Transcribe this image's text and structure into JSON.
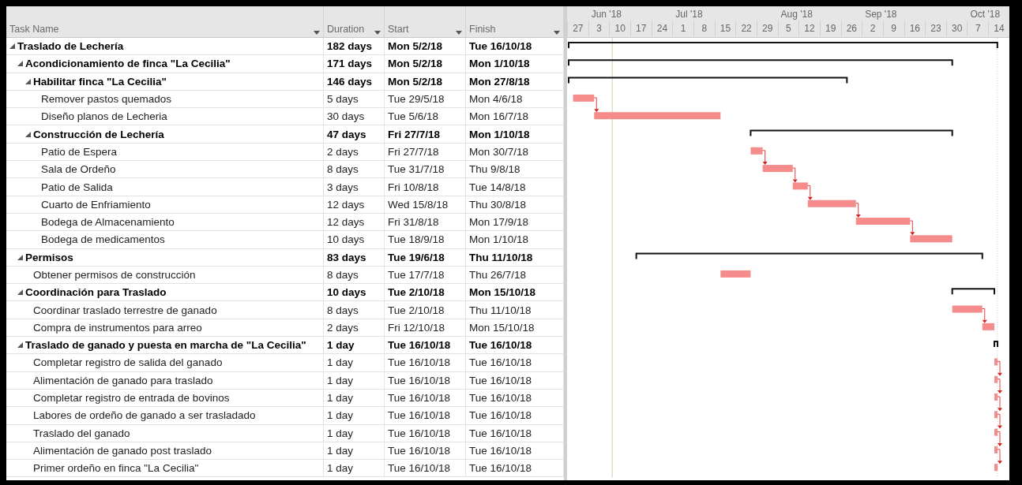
{
  "table": {
    "columns": [
      "Task Name",
      "Duration",
      "Start",
      "Finish"
    ],
    "rows": [
      {
        "kind": "summary",
        "expanded": true,
        "name": "Traslado de Lechería",
        "duration": "182 days",
        "start": "Mon 5/2/18",
        "finish": "Tue 16/10/18",
        "children": [
          {
            "kind": "summary",
            "expanded": true,
            "name": "Acondicionamiento de finca \"La Cecilia\"",
            "duration": "171 days",
            "start": "Mon 5/2/18",
            "finish": "Mon 1/10/18",
            "children": [
              {
                "kind": "summary",
                "expanded": true,
                "name": "Habilitar finca \"La Cecilia\"",
                "duration": "146 days",
                "start": "Mon 5/2/18",
                "finish": "Mon 27/8/18",
                "children": [
                  {
                    "kind": "task",
                    "name": "Remover pastos quemados",
                    "duration": "5 days",
                    "start": "Tue 29/5/18",
                    "finish": "Mon 4/6/18"
                  },
                  {
                    "kind": "task",
                    "name": "Diseño planos de Lecheria",
                    "duration": "30 days",
                    "start": "Tue 5/6/18",
                    "finish": "Mon 16/7/18"
                  }
                ]
              },
              {
                "kind": "summary",
                "expanded": true,
                "name": "Construcción de Lechería",
                "duration": "47 days",
                "start": "Fri 27/7/18",
                "finish": "Mon 1/10/18",
                "children": [
                  {
                    "kind": "task",
                    "name": "Patio de Espera",
                    "duration": "2 days",
                    "start": "Fri 27/7/18",
                    "finish": "Mon 30/7/18"
                  },
                  {
                    "kind": "task",
                    "name": "Sala de Ordeño",
                    "duration": "8 days",
                    "start": "Tue 31/7/18",
                    "finish": "Thu 9/8/18"
                  },
                  {
                    "kind": "task",
                    "name": "Patio de Salida",
                    "duration": "3 days",
                    "start": "Fri 10/8/18",
                    "finish": "Tue 14/8/18"
                  },
                  {
                    "kind": "task",
                    "name": "Cuarto de Enfriamiento",
                    "duration": "12 days",
                    "start": "Wed 15/8/18",
                    "finish": "Thu 30/8/18"
                  },
                  {
                    "kind": "task",
                    "name": "Bodega de Almacenamiento",
                    "duration": "12 days",
                    "start": "Fri 31/8/18",
                    "finish": "Mon 17/9/18"
                  },
                  {
                    "kind": "task",
                    "name": "Bodega de medicamentos",
                    "duration": "10 days",
                    "start": "Tue 18/9/18",
                    "finish": "Mon 1/10/18"
                  }
                ]
              }
            ]
          },
          {
            "kind": "summary",
            "expanded": true,
            "name": "Permisos",
            "duration": "83 days",
            "start": "Tue 19/6/18",
            "finish": "Thu 11/10/18",
            "children": [
              {
                "kind": "task",
                "name": "Obtener permisos de construcción",
                "duration": "8 days",
                "start": "Tue 17/7/18",
                "finish": "Thu 26/7/18"
              }
            ]
          },
          {
            "kind": "summary",
            "expanded": true,
            "name": "Coordinación para Traslado",
            "duration": "10 days",
            "start": "Tue 2/10/18",
            "finish": "Mon 15/10/18",
            "children": [
              {
                "kind": "task",
                "name": "Coordinar traslado terrestre de ganado",
                "duration": "8 days",
                "start": "Tue 2/10/18",
                "finish": "Thu 11/10/18"
              },
              {
                "kind": "task",
                "name": "Compra de instrumentos para arreo",
                "duration": "2 days",
                "start": "Fri 12/10/18",
                "finish": "Mon 15/10/18"
              }
            ]
          },
          {
            "kind": "summary",
            "expanded": true,
            "name": "Traslado de ganado y puesta en marcha de \"La Cecilia\"",
            "duration": "1 day",
            "start": "Tue 16/10/18",
            "finish": "Tue 16/10/18",
            "children": [
              {
                "kind": "task",
                "name": "Completar registro de salida del ganado",
                "duration": "1 day",
                "start": "Tue 16/10/18",
                "finish": "Tue 16/10/18"
              },
              {
                "kind": "task",
                "name": "Alimentación de ganado para traslado",
                "duration": "1 day",
                "start": "Tue 16/10/18",
                "finish": "Tue 16/10/18"
              },
              {
                "kind": "task",
                "name": "Completar registro de entrada de bovinos",
                "duration": "1 day",
                "start": "Tue 16/10/18",
                "finish": "Tue 16/10/18"
              },
              {
                "kind": "task",
                "name": "Labores de ordeño de ganado a ser trasladado",
                "duration": "1 day",
                "start": "Tue 16/10/18",
                "finish": "Tue 16/10/18"
              },
              {
                "kind": "task",
                "name": "Traslado del ganado",
                "duration": "1 day",
                "start": "Tue 16/10/18",
                "finish": "Tue 16/10/18"
              },
              {
                "kind": "task",
                "name": "Alimentación de ganado post traslado",
                "duration": "1 day",
                "start": "Tue 16/10/18",
                "finish": "Tue 16/10/18"
              },
              {
                "kind": "task",
                "name": "Primer ordeño en finca \"La Cecilia\"",
                "duration": "1 day",
                "start": "Tue 16/10/18",
                "finish": "Tue 16/10/18"
              }
            ]
          }
        ]
      }
    ]
  },
  "timeline": {
    "months": [
      "Jun '18",
      "Jul '18",
      "Aug '18",
      "Sep '18",
      "Oct '18"
    ],
    "weeks": [
      "27",
      "3",
      "10",
      "17",
      "24",
      "1",
      "8",
      "15",
      "22",
      "29",
      "5",
      "12",
      "19",
      "26",
      "2",
      "9",
      "16",
      "23",
      "30",
      "7",
      "14"
    ]
  }
}
